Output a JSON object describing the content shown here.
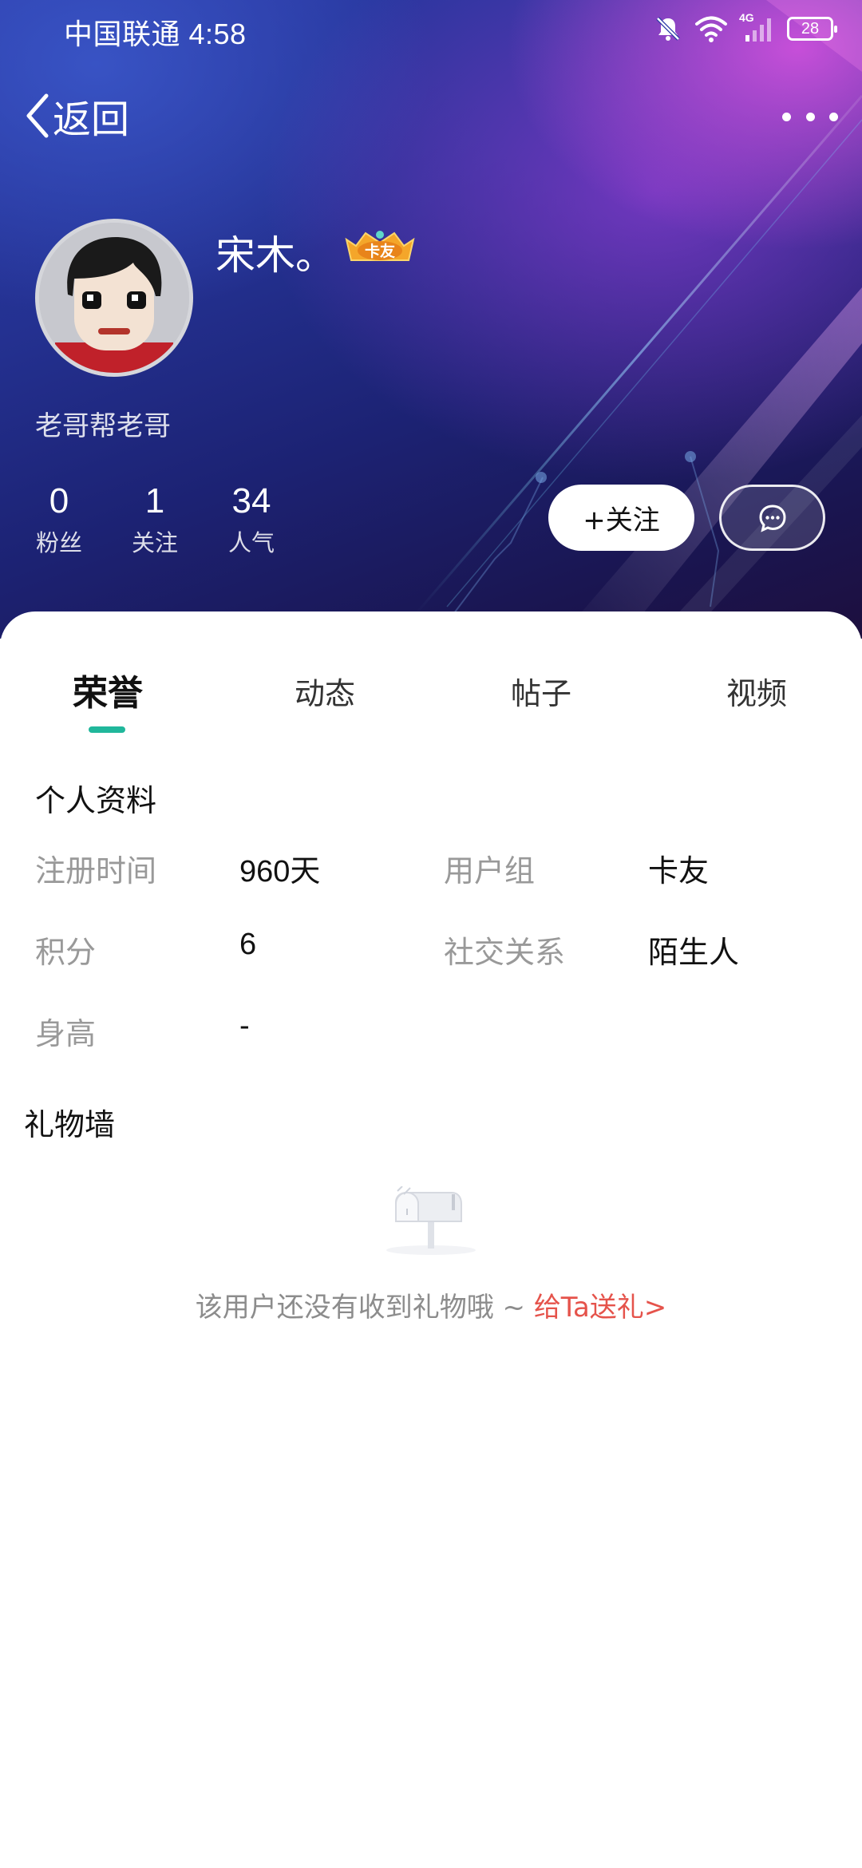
{
  "status_bar": {
    "carrier_time": "中国联通 4:58",
    "network": "4G",
    "battery": "28"
  },
  "nav": {
    "back_label": "返回"
  },
  "profile": {
    "username": "宋木。",
    "badge_label": "卡友",
    "signature": "老哥帮老哥",
    "stats": [
      {
        "value": "0",
        "label": "粉丝"
      },
      {
        "value": "1",
        "label": "关注"
      },
      {
        "value": "34",
        "label": "人气"
      }
    ],
    "follow_label": "+关注"
  },
  "tabs": [
    {
      "label": "荣誉",
      "active": true
    },
    {
      "label": "动态",
      "active": false
    },
    {
      "label": "帖子",
      "active": false
    },
    {
      "label": "视频",
      "active": false
    }
  ],
  "personal_info": {
    "title": "个人资料",
    "fields": [
      {
        "label": "注册时间",
        "value": "960天"
      },
      {
        "label": "用户组",
        "value": "卡友"
      },
      {
        "label": "积分",
        "value": "6"
      },
      {
        "label": "社交关系",
        "value": "陌生人"
      },
      {
        "label": "身高",
        "value": "-"
      }
    ]
  },
  "gift_wall": {
    "title": "礼物墙",
    "empty_text": "该用户还没有收到礼物哦 ~ ",
    "gift_link": "给Ta送礼>"
  },
  "colors": {
    "accent_tab": "#20b79b",
    "gift_link": "#e5534b",
    "badge_gold": "#f4a62a"
  }
}
